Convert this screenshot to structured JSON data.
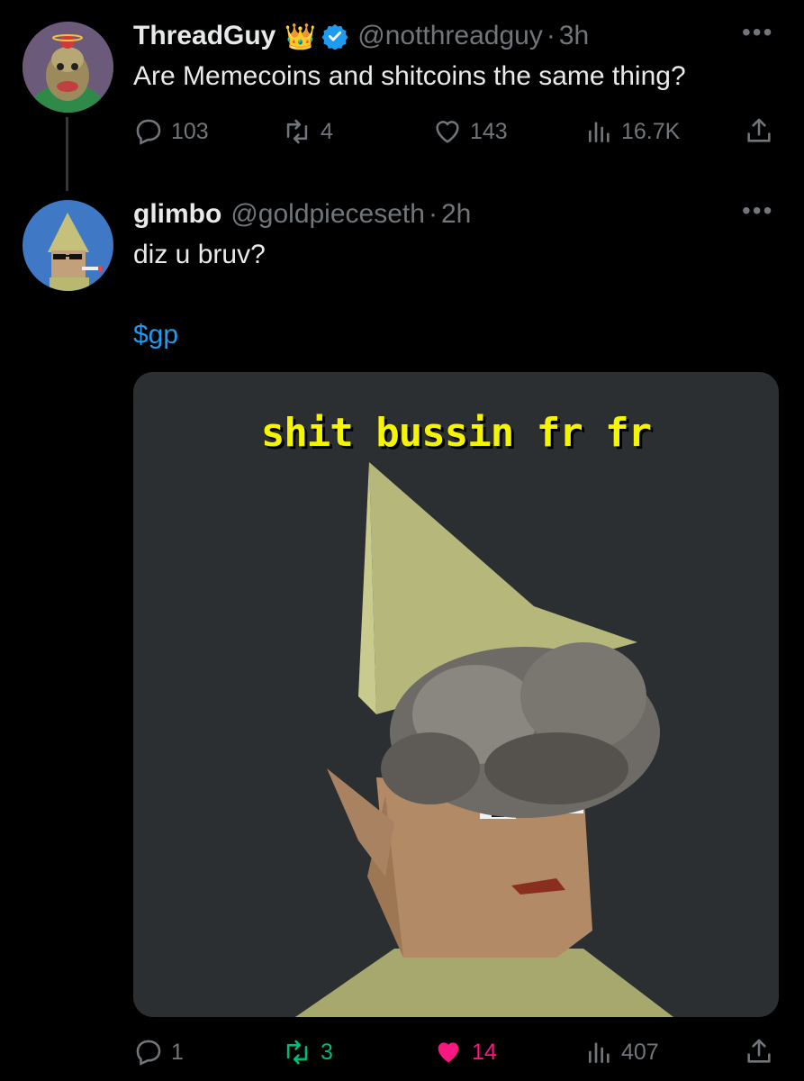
{
  "tweet": {
    "author_name": "ThreadGuy",
    "badge_emoji": "👑",
    "handle": "@notthreadguy",
    "separator": "·",
    "time": "3h",
    "text": "Are Memecoins and shitcoins the same thing?",
    "replies": "103",
    "reposts": "4",
    "likes": "143",
    "views": "16.7K"
  },
  "reply": {
    "author_name": "glimbo",
    "handle": "@goldpieceseth",
    "separator": "·",
    "time": "2h",
    "text": "diz u bruv?",
    "cashtag": "$gp",
    "media_caption": "shit bussin fr fr",
    "replies": "1",
    "reposts": "3",
    "likes": "14",
    "views": "407"
  },
  "colors": {
    "verified": "#1d9bf0",
    "repost_active": "#00ba7c",
    "like_active": "#f91880",
    "muted": "#71767b"
  }
}
